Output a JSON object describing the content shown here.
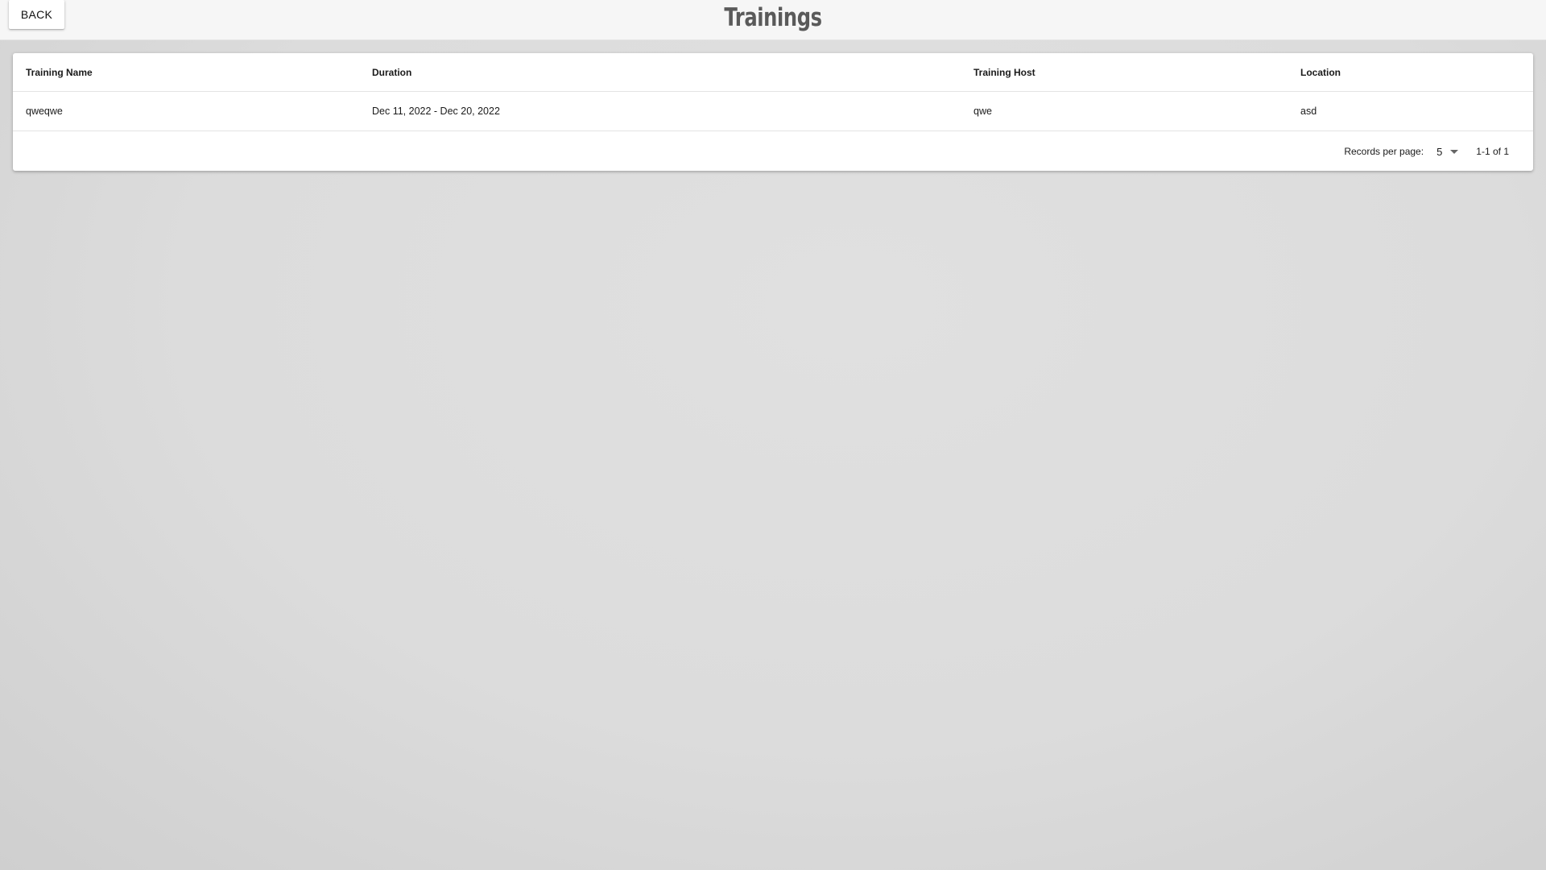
{
  "header": {
    "back_label": "BACK",
    "title": "Trainings"
  },
  "table": {
    "columns": [
      "Training Name",
      "Duration",
      "Training Host",
      "Location"
    ],
    "rows": [
      {
        "name": "qweqwe",
        "duration": "Dec 11, 2022 - Dec 20, 2022",
        "host": "qwe",
        "location": "asd"
      }
    ]
  },
  "pagination": {
    "records_per_page_label": "Records per page:",
    "records_per_page_value": "5",
    "range_text": "1-1 of 1"
  },
  "icons": {
    "dropdown": "chevron-down-icon"
  }
}
